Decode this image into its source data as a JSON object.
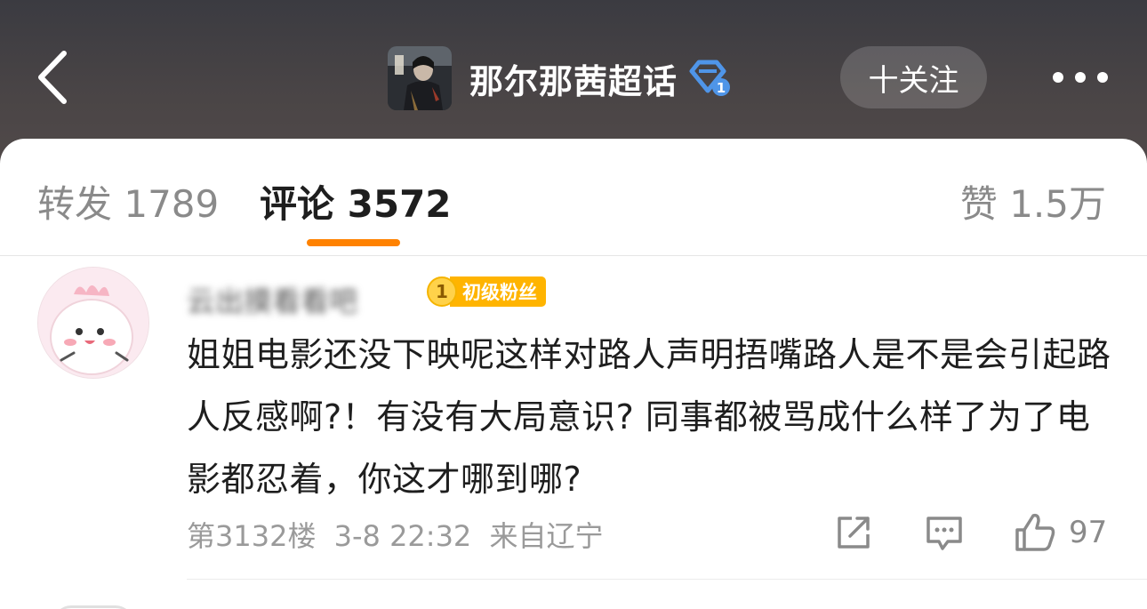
{
  "header": {
    "topic_title": "那尔那茜超话",
    "follow_label": "十关注",
    "icons": {
      "back": "chevron-left-icon",
      "verify": "diamond-badge-icon",
      "more": "more-dots-icon"
    }
  },
  "tabs": [
    {
      "label": "转发 1789",
      "active": false
    },
    {
      "label": "评论 3572",
      "active": true
    },
    {
      "label": "赞 1.5万",
      "active": false
    }
  ],
  "comment": {
    "username": "云出摸看看吧",
    "fan_badge": {
      "level": "1",
      "label": "初级粉丝"
    },
    "text": "姐姐电影还没下映呢这样对路人声明捂嘴路人是不是会引起路人反感啊?！有没有大局意识? 同事都被骂成什么样了为了电影都忍着，你这才哪到哪?",
    "floor": "第3132楼",
    "time": "3-8 22:32",
    "location": "来自辽宁",
    "like_count": "97"
  },
  "colors": {
    "accent": "#ff8200",
    "fan_badge": "#ffb400",
    "header_bg": "#45403f"
  }
}
